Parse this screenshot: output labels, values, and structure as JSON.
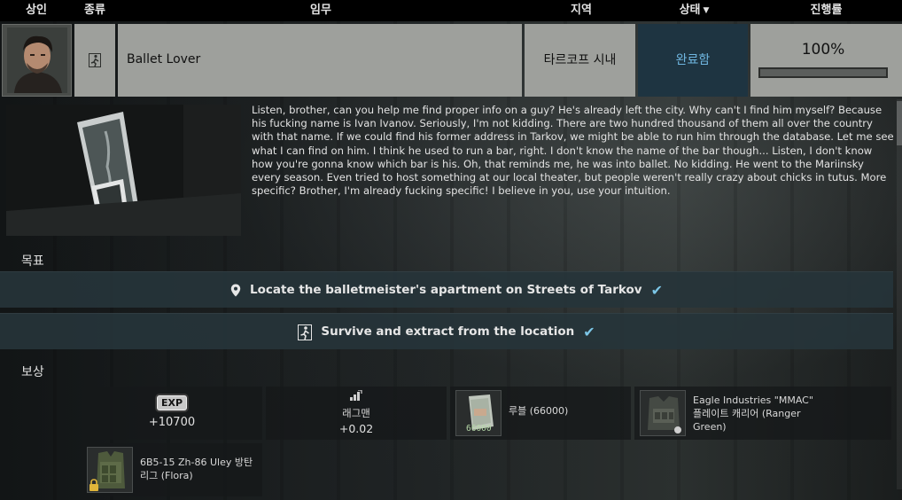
{
  "header": {
    "trader": "상인",
    "type": "종류",
    "task": "임무",
    "location": "지역",
    "status": "상태",
    "progress": "진행률"
  },
  "quest": {
    "name": "Ballet Lover",
    "location": "타르코프 시내",
    "status": "완료함",
    "progress_text": "100%",
    "progress_value": 1.0,
    "type_icon": "exit-icon",
    "trader_avatar": "trader-portrait"
  },
  "description": "Listen, brother, can you help me find proper info on a guy? He's already left the city. Why can't I find him myself? Because his fucking name is Ivan Ivanov. Seriously, I'm not kidding. There are two hundred thousand of them all over the country with that name. If we could find his former address in Tarkov, we might be able to run him through the database. Let me see what I can find on him. I think he used to run a bar, right. I don't know the name of the bar though... Listen, I don't know how you're gonna know which bar is his. Oh, that reminds me, he was into ballet. No kidding. He went to the Mariinsky every season. Even tried to host something at our local theater, but people weren't really crazy about chicks in tutus. More specific? Brother, I'm already fucking specific! I believe in you, use your intuition.",
  "objectives": {
    "label": "목표",
    "items": [
      {
        "text": "Locate the balletmeister's apartment on Streets of Tarkov",
        "icon": "location-pin-icon",
        "done": true
      },
      {
        "text": "Survive and extract from the location",
        "icon": "exit-icon",
        "done": true
      }
    ]
  },
  "rewards": {
    "label": "보상",
    "exp": {
      "badge": "EXP",
      "value": "+10700"
    },
    "rep": {
      "name": "래그맨",
      "value": "+0.02",
      "icon": "reputation-icon"
    },
    "rubles": {
      "name": "루블 (66000)",
      "count": "66000"
    },
    "armor": {
      "name_line1": "Eagle Industries \"MMAC\"",
      "name_line2": "플레이트 캐리어 (Ranger",
      "name_line3": "Green)"
    },
    "rig": {
      "name_line1": "6B5-15 Zh-86 Uley 방탄",
      "name_line2": "리그 (Flora)"
    }
  },
  "colors": {
    "status_text": "#6fb6e0",
    "check": "#7cc6e6",
    "cell_bg": "#9ea09c",
    "status_bg": "#1e3441"
  }
}
